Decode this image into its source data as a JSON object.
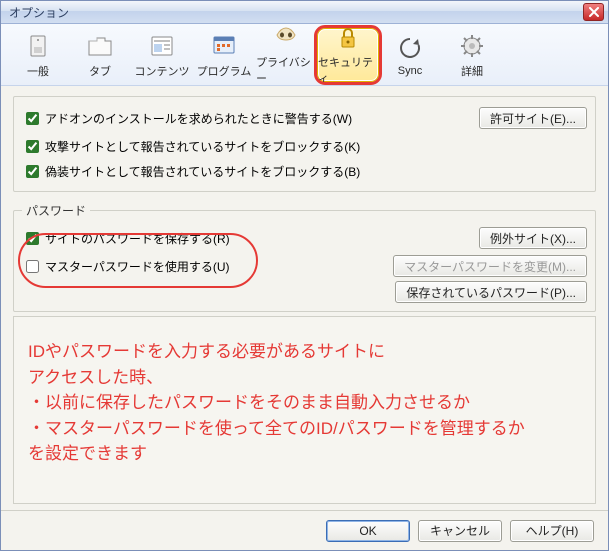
{
  "window": {
    "title": "オプション"
  },
  "toolbar": {
    "items": [
      {
        "label": "一般"
      },
      {
        "label": "タブ"
      },
      {
        "label": "コンテンツ"
      },
      {
        "label": "プログラム"
      },
      {
        "label": "プライバシー"
      },
      {
        "label": "セキュリティ"
      },
      {
        "label": "Sync"
      },
      {
        "label": "詳細"
      }
    ]
  },
  "security": {
    "addon_warn": "アドオンのインストールを求められたときに警告する(W)",
    "block_attack": "攻撃サイトとして報告されているサイトをブロックする(K)",
    "block_forgery": "偽装サイトとして報告されているサイトをブロックする(B)",
    "exceptions_btn": "許可サイト(E)..."
  },
  "passwords": {
    "legend": "パスワード",
    "save_pw": "サイトのパスワードを保存する(R)",
    "use_master": "マスターパスワードを使用する(U)",
    "exceptions_btn": "例外サイト(X)...",
    "change_master_btn": "マスターパスワードを変更(M)...",
    "saved_btn": "保存されているパスワード(P)..."
  },
  "annotation": {
    "line1": "IDやパスワードを入力する必要があるサイトに",
    "line2": "アクセスした時、",
    "line3": "・以前に保存したパスワードをそのまま自動入力させるか",
    "line4": "・マスターパスワードを使って全てのID/パスワードを管理するか",
    "line5": "を設定できます"
  },
  "footer": {
    "ok": "OK",
    "cancel": "キャンセル",
    "help": "ヘルプ(H)"
  }
}
